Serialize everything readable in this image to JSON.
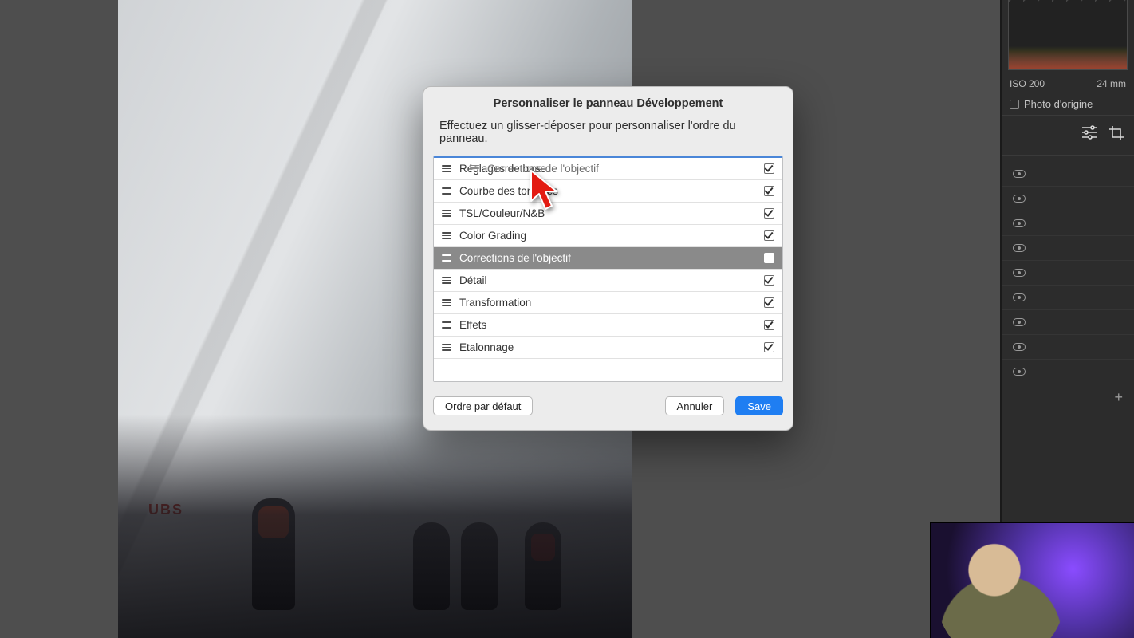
{
  "right_panel": {
    "iso": "ISO 200",
    "focal": "24 mm",
    "origin_label": "Photo d'origine",
    "eye_rows": 9
  },
  "dialog": {
    "title": "Personnaliser le panneau Développement",
    "instruction": "Effectuez un glisser-déposer pour personnaliser l'ordre du panneau.",
    "rows": [
      {
        "label": "Réglages de base",
        "checked": true,
        "selected": false
      },
      {
        "label": "Courbe des tonalités",
        "checked": true,
        "selected": false
      },
      {
        "label": "TSL/Couleur/N&B",
        "checked": true,
        "selected": false
      },
      {
        "label": "Color Grading",
        "checked": true,
        "selected": false
      },
      {
        "label": "Corrections de l'objectif",
        "checked": true,
        "selected": true
      },
      {
        "label": "Détail",
        "checked": true,
        "selected": false
      },
      {
        "label": "Transformation",
        "checked": true,
        "selected": false
      },
      {
        "label": "Effets",
        "checked": true,
        "selected": false
      },
      {
        "label": "Etalonnage",
        "checked": true,
        "selected": false
      }
    ],
    "ghost_label": "Corrections de l'objectif",
    "buttons": {
      "default_order": "Ordre par défaut",
      "cancel": "Annuler",
      "save": "Save"
    }
  },
  "photo": {
    "sign": "UBS"
  }
}
